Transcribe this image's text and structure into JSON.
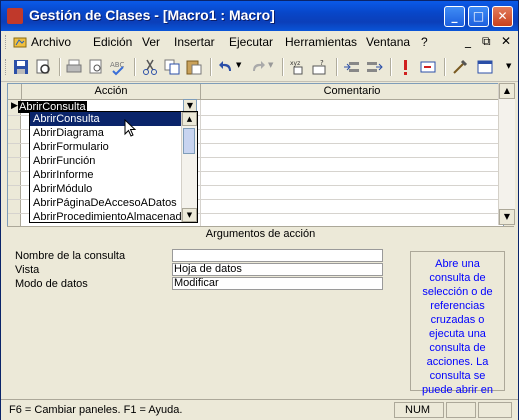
{
  "window": {
    "title": "Gestión de Clases - [Macro1 : Macro]"
  },
  "title_buttons": {
    "minimize": "_",
    "maximize": "□",
    "close": "✕"
  },
  "menu": {
    "items": [
      "Archivo",
      "Edición",
      "Ver",
      "Insertar",
      "Ejecutar",
      "Herramientas",
      "Ventana",
      "?"
    ],
    "controls": [
      "_",
      "⧉",
      "✕"
    ]
  },
  "toolbar": {
    "icons": [
      "save-icon",
      "print-preview-icon",
      "print-icon",
      "preview-icon",
      "spelling-icon",
      "cut-icon",
      "copy-icon",
      "paste-icon",
      "undo-icon",
      "redo-icon",
      "macro-names-icon",
      "conditions-icon",
      "insert-rows-icon",
      "delete-rows-icon",
      "run-icon",
      "step-icon",
      "build-icon",
      "database-window-icon",
      "new-object-icon"
    ]
  },
  "grid": {
    "columns": {
      "action": "Acción",
      "comment": "Comentario"
    },
    "current_row": {
      "marker": "▶",
      "action": "AbrirConsulta",
      "comment": ""
    },
    "dropdown_arrow": "▼"
  },
  "dropdown": {
    "items": [
      "AbrirConsulta",
      "AbrirDiagrama",
      "AbrirFormulario",
      "AbrirFunción",
      "AbrirInforme",
      "AbrirMódulo",
      "AbrirPáginaDeAccesoADatos",
      "AbrirProcedimientoAlmacenado"
    ],
    "selected_index": 0,
    "scroll_up": "▲",
    "scroll_down": "▼"
  },
  "scrollbar": {
    "up": "▲",
    "down": "▼"
  },
  "arguments": {
    "title": "Argumentos de acción",
    "fields": [
      {
        "label": "Nombre de la consulta",
        "value": ""
      },
      {
        "label": "Vista",
        "value": "Hoja de datos"
      },
      {
        "label": "Modo de datos",
        "value": "Modificar"
      }
    ],
    "help": "Abre una consulta de selección o de referencias cruzadas o ejecuta una consulta de acciones. La consulta se puede abrir en"
  },
  "status": {
    "text": "F6 = Cambiar paneles.  F1 = Ayuda.",
    "num": "NUM"
  }
}
